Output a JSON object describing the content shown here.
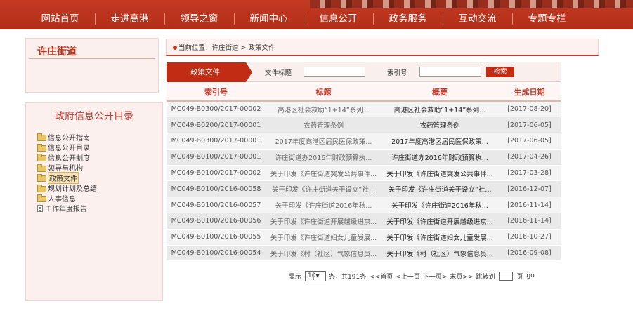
{
  "nav": {
    "items": [
      "网站首页",
      "走进高港",
      "领导之窗",
      "新闻中心",
      "信息公开",
      "政务服务",
      "互动交流",
      "专题专栏"
    ]
  },
  "sidebar": {
    "street_title": "许庄街道",
    "catalog_title": "政府信息公开目录",
    "tree": [
      {
        "label": "信息公开指南",
        "icon": "folder-icon",
        "active": false
      },
      {
        "label": "信息公开目录",
        "icon": "folder-icon",
        "active": false
      },
      {
        "label": "信息公开制度",
        "icon": "folder-icon",
        "active": false
      },
      {
        "label": "领导与机构",
        "icon": "folder-icon",
        "active": false
      },
      {
        "label": "政策文件",
        "icon": "folder-icon",
        "active": true
      },
      {
        "label": "规划计划及总结",
        "icon": "folder-icon",
        "active": false
      },
      {
        "label": "人事信息",
        "icon": "folder-icon",
        "active": false
      },
      {
        "label": "工作年度报告",
        "icon": "document-icon",
        "active": false
      }
    ]
  },
  "breadcrumb": {
    "text": "当前位置：许庄街道 > 政策文件"
  },
  "search": {
    "tab_label": "政策文件",
    "title_label": "文件标题",
    "title_value": "",
    "index_label": "索引号",
    "index_value": "",
    "button_label": "检索"
  },
  "table": {
    "headers": [
      "索引号",
      "标题",
      "概要",
      "生成日期"
    ],
    "rows": [
      [
        "MC049-B0300/2017-00002",
        "高港区社会救助“1+14”系列...",
        "高港区社会救助“1+14”系列...",
        "[2017-08-20]"
      ],
      [
        "MC049-B0200/2017-00001",
        "农药管理条例",
        "农药管理条例",
        "[2017-06-05]"
      ],
      [
        "MC049-B0300/2017-00001",
        "2017年度高港区居民医保政策...",
        "2017年度高港区居民医保政策...",
        "[2017-06-05]"
      ],
      [
        "MC049-B0100/2017-00001",
        "许庄街道办2016年财政预算执...",
        "许庄街道办2016年财政预算执...",
        "[2017-04-26]"
      ],
      [
        "MC049-B0100/2017-00002",
        "关于印发《许庄街道突发公共事件...",
        "关于印发《许庄街道突发公共事件...",
        "[2017-03-28]"
      ],
      [
        "MC049-B0100/2016-00058",
        "关于印发《许庄街道关于设立“社...",
        "关于印发《许庄街道关于设立“社...",
        "[2016-12-07]"
      ],
      [
        "MC049-B0100/2016-00057",
        "关于印发《许庄街道2016年秋...",
        "关于印发《许庄街道2016年秋...",
        "[2016-11-14]"
      ],
      [
        "MC049-B0100/2016-00056",
        "关于印发《许庄街道开展越级进京...",
        "关于印发《许庄街道开展越级进京...",
        "[2016-11-14]"
      ],
      [
        "MC049-B0100/2016-00055",
        "关于印发《许庄街道妇女儿童发展...",
        "关于印发《许庄街道妇女儿童发展...",
        "[2016-10-27]"
      ],
      [
        "MC049-B0100/2016-00054",
        "关于印发《村（社区）气象信息员...",
        "关于印发《村（社区）气象信息员...",
        "[2016-09-08]"
      ]
    ]
  },
  "pager": {
    "show_label": "显示",
    "page_size": "10",
    "summary": "条，共191条",
    "first": "<<首页",
    "prev": "<上一页",
    "next": "下一页>",
    "last": "末页>>",
    "jump_label": "跳转到",
    "page_unit": "页",
    "go_label": "go"
  }
}
